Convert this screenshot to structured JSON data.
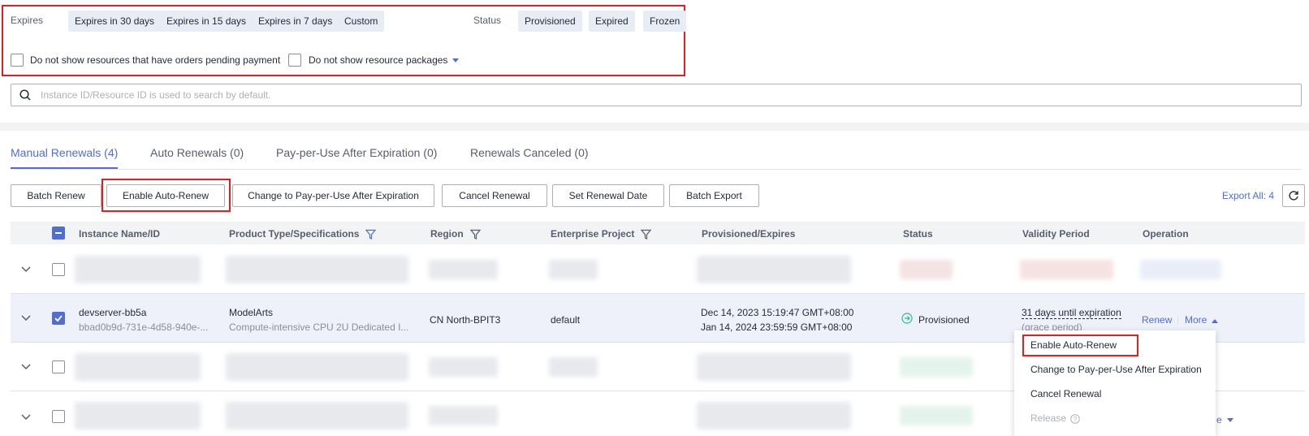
{
  "filters": {
    "expires_label": "Expires",
    "expires_options": [
      "Expires in 30 days",
      "Expires in 15 days",
      "Expires in 7 days",
      "Custom"
    ],
    "status_label": "Status",
    "status_options": [
      "Provisioned",
      "Expired",
      "Frozen"
    ],
    "hide_pending_label": "Do not show resources that have orders pending payment",
    "hide_packages_label": "Do not show resource packages"
  },
  "search": {
    "placeholder": "Instance ID/Resource ID is used to search by default."
  },
  "tabs": [
    {
      "label": "Manual Renewals (4)",
      "active": true
    },
    {
      "label": "Auto Renewals (0)",
      "active": false
    },
    {
      "label": "Pay-per-Use After Expiration (0)",
      "active": false
    },
    {
      "label": "Renewals Canceled (0)",
      "active": false
    }
  ],
  "toolbar": {
    "batch_renew": "Batch Renew",
    "enable_auto_renew": "Enable Auto-Renew",
    "change_ppu": "Change to Pay-per-Use After Expiration",
    "cancel_renewal": "Cancel Renewal",
    "set_renewal_date": "Set Renewal Date",
    "batch_export": "Batch Export",
    "export_all": "Export All: 4"
  },
  "table": {
    "columns": [
      "Instance Name/ID",
      "Product Type/Specifications",
      "Region",
      "Enterprise Project",
      "Provisioned/Expires",
      "Status",
      "Validity Period",
      "Operation"
    ],
    "selected_row": {
      "name": "devserver-bb5a",
      "id": "bbad0b9d-731e-4d58-940e-...",
      "product": "ModelArts",
      "spec": "Compute-intensive CPU 2U Dedicated I...",
      "region": "CN North-BPIT3",
      "enterprise_project": "default",
      "provisioned": "Dec 14, 2023 15:19:47 GMT+08:00",
      "expires": "Jan 14, 2024 23:59:59 GMT+08:00",
      "status": "Provisioned",
      "validity": "31 days until expiration",
      "validity_note": "(grace period)",
      "renew": "Renew",
      "more": "More"
    },
    "partial_more": "e"
  },
  "more_menu": {
    "items": [
      "Enable Auto-Renew",
      "Change to Pay-per-Use After Expiration",
      "Cancel Renewal",
      "Release"
    ]
  },
  "colors": {
    "accent": "#526ecc",
    "highlight_border": "#e02020",
    "status_ok": "#2fb98a"
  }
}
